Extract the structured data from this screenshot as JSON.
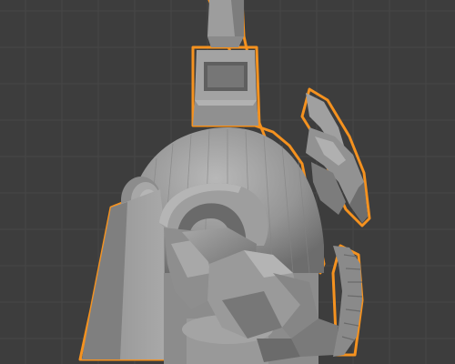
{
  "viewport": {
    "kind": "3d-viewport",
    "background_color": "#3d3d3d",
    "grid_color": "#474747",
    "grid_visible": true
  },
  "object": {
    "selected": true,
    "outline_color": "#f5921f",
    "base_shade": "#9a9a9a",
    "shadow_shade": "#6f6f6f",
    "highlight_shade": "#bdbdbd"
  }
}
